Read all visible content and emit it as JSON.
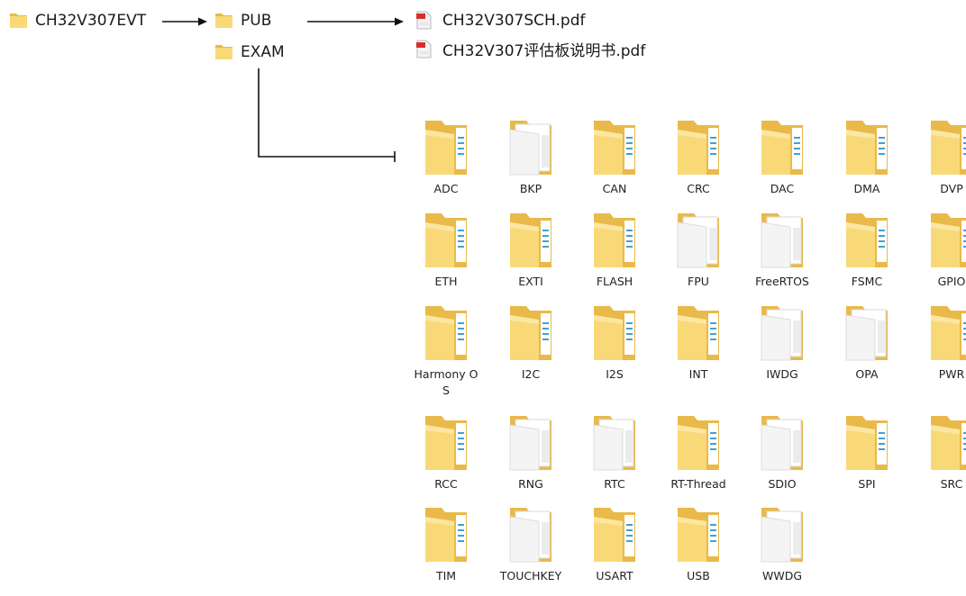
{
  "root": {
    "label": "CH32V307EVT"
  },
  "pub": {
    "label": "PUB"
  },
  "exam": {
    "label": "EXAM"
  },
  "pdfs": [
    {
      "label": "CH32V307SCH.pdf",
      "icon": "pdf-icon"
    },
    {
      "label": "CH32V307评估板说明书.pdf",
      "icon": "pdf-icon"
    }
  ],
  "colors": {
    "folder_back": "#E9B949",
    "folder_front": "#F9D977",
    "folder_light": "#FBE6A2",
    "paper": "#F4F4F4",
    "stripe": "#3FA1D8",
    "arrow": "#111111"
  },
  "exam_folders": [
    [
      "ADC",
      "BKP",
      "CAN",
      "CRC",
      "DAC",
      "DMA",
      "DVP"
    ],
    [
      "ETH",
      "EXTI",
      "FLASH",
      "FPU",
      "FreeRTOS",
      "FSMC",
      "GPIO"
    ],
    [
      "Harmony OS",
      "I2C",
      "I2S",
      "INT",
      "IWDG",
      "OPA",
      "PWR"
    ],
    [
      "RCC",
      "RNG",
      "RTC",
      "RT-Thread",
      "SDIO",
      "SPI",
      "SRC"
    ],
    [
      "TIM",
      "TOUCHKEY",
      "USART",
      "USB",
      "WWDG"
    ]
  ],
  "paper_folders": [
    "BKP",
    "FPU",
    "FreeRTOS",
    "IWDG",
    "OPA",
    "RNG",
    "RTC",
    "SDIO",
    "TOUCHKEY",
    "WWDG"
  ]
}
